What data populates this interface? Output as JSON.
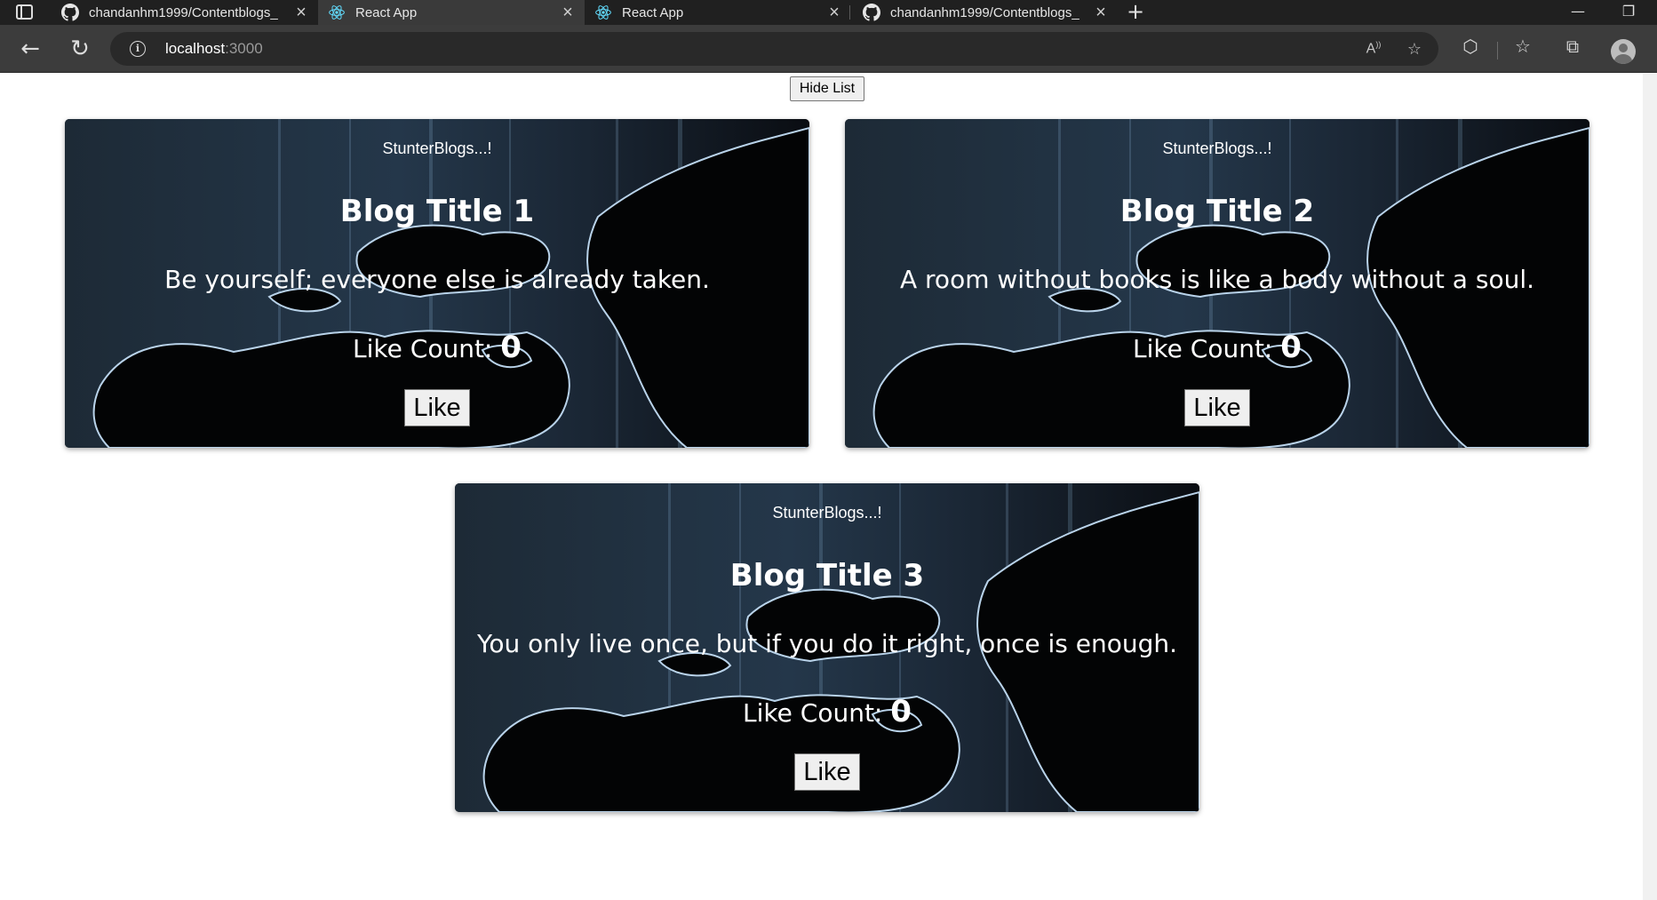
{
  "browser": {
    "tabs": [
      {
        "title": "chandanhm1999/Contentblogs_",
        "icon": "github-icon",
        "active": false
      },
      {
        "title": "React App",
        "icon": "react-icon",
        "active": true
      },
      {
        "title": "React App",
        "icon": "react-icon",
        "active": false
      },
      {
        "title": "chandanhm1999/Contentblogs_",
        "icon": "github-icon",
        "active": false
      }
    ],
    "url_host": "localhost",
    "url_port": ":3000"
  },
  "page": {
    "hide_list_label": "Hide List"
  },
  "cards": [
    {
      "brand": "StunterBlogs...!",
      "title": "Blog Title 1",
      "quote": "Be yourself; everyone else is already taken.",
      "like_count_label": "Like Count:",
      "like_count": "0",
      "like_label": "Like"
    },
    {
      "brand": "StunterBlogs...!",
      "title": "Blog Title 2",
      "quote": "A room without books is like a body without a soul.",
      "like_count_label": "Like Count:",
      "like_count": "0",
      "like_label": "Like"
    },
    {
      "brand": "StunterBlogs...!",
      "title": "Blog Title 3",
      "quote": "You only live once, but if you do it right, once is enough.",
      "like_count_label": "Like Count:",
      "like_count": "0",
      "like_label": "Like"
    }
  ]
}
